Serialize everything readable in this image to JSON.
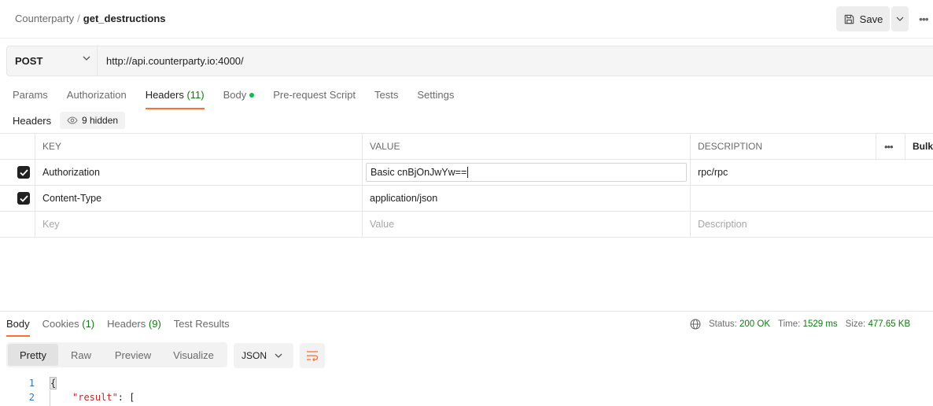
{
  "breadcrumb": {
    "parent": "Counterparty",
    "separator": "/",
    "current": "get_destructions"
  },
  "toolbar": {
    "save_label": "Save",
    "more_icon": "more-horizontal-icon"
  },
  "request": {
    "method": "POST",
    "url": "http://api.counterparty.io:4000/"
  },
  "request_tabs": [
    {
      "label": "Params"
    },
    {
      "label": "Authorization"
    },
    {
      "label": "Headers",
      "count": "(11)"
    },
    {
      "label": "Body"
    },
    {
      "label": "Pre-request Script"
    },
    {
      "label": "Tests"
    },
    {
      "label": "Settings"
    }
  ],
  "headers_section": {
    "label": "Headers",
    "hidden_label": "9 hidden"
  },
  "headers_table": {
    "columns": {
      "key": "KEY",
      "value": "VALUE",
      "description": "DESCRIPTION",
      "bulk": "Bulk Edit"
    },
    "rows": [
      {
        "checked": true,
        "key": "Authorization",
        "value": "Basic cnBjOnJwYw==",
        "description": "rpc/rpc"
      },
      {
        "checked": true,
        "key": "Content-Type",
        "value": "application/json",
        "description": ""
      }
    ],
    "placeholders": {
      "key": "Key",
      "value": "Value",
      "description": "Description"
    }
  },
  "response_tabs": [
    {
      "label": "Body"
    },
    {
      "label": "Cookies",
      "count": "(1)"
    },
    {
      "label": "Headers",
      "count": "(9)"
    },
    {
      "label": "Test Results"
    }
  ],
  "response_meta": {
    "status_label": "Status:",
    "status": "200 OK",
    "time_label": "Time:",
    "time": "1529 ms",
    "size_label": "Size:",
    "size": "477.65 KB"
  },
  "view_modes": [
    "Pretty",
    "Raw",
    "Preview",
    "Visualize"
  ],
  "active_view": "Pretty",
  "format": "JSON",
  "code": [
    {
      "line": "1",
      "text": "{"
    },
    {
      "line": "2",
      "key": "\"result\"",
      "rest": ": ["
    }
  ],
  "colors": {
    "accent": "#ff6c37",
    "status_green": "#0f7b0f",
    "dot_green": "#0cbb52"
  }
}
